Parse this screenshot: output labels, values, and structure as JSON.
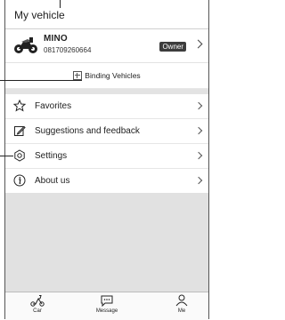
{
  "header": {
    "title": "My vehicle"
  },
  "vehicle": {
    "name": "MINO",
    "number": "081709260664",
    "badge": "Owner"
  },
  "binding": {
    "label": "Binding Vehicles"
  },
  "menu": {
    "items": [
      {
        "label": "Favorites",
        "icon": "star-icon"
      },
      {
        "label": "Suggestions and feedback",
        "icon": "edit-icon"
      },
      {
        "label": "Settings",
        "icon": "gear-icon"
      },
      {
        "label": "About us",
        "icon": "info-icon"
      }
    ]
  },
  "tabs": [
    {
      "label": "Car",
      "icon": "scooter-icon"
    },
    {
      "label": "Message",
      "icon": "chat-icon"
    },
    {
      "label": "Me",
      "icon": "person-icon"
    }
  ]
}
